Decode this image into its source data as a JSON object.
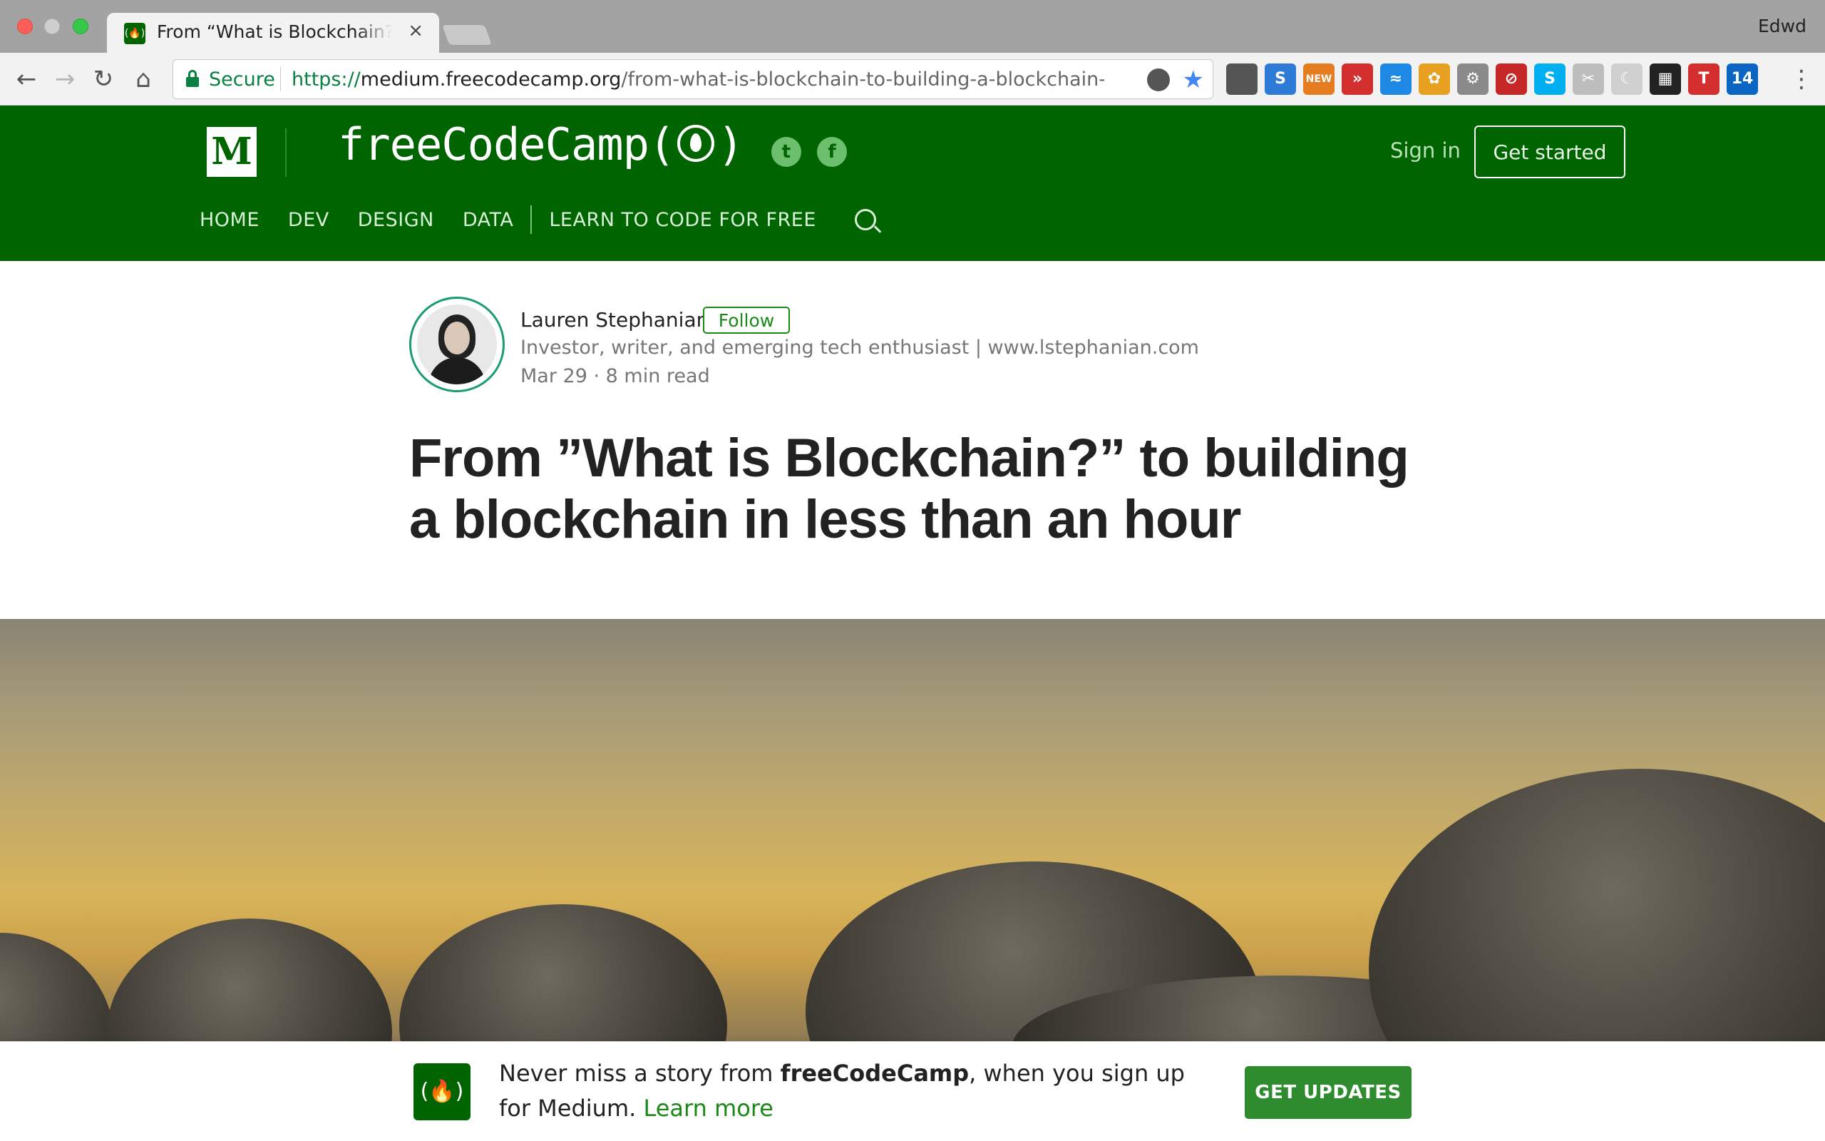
{
  "browser": {
    "tab_title": "From “What is Blockchain?” to building a blockchain in less than an hour",
    "tab_close": "×",
    "profile": "Edwd",
    "secure_label": "Secure",
    "url_scheme": "https://",
    "url_host": "medium.freecodecamp.org",
    "url_path": "/from-what-is-blockchain-to-building-a-blockchain-wit...",
    "back": "←",
    "forward": "→",
    "reload": "↻",
    "home": "⌂",
    "star": "★",
    "menu": "⋮",
    "extensions": [
      {
        "name": "evernote-icon",
        "color": "#555555",
        "label": ""
      },
      {
        "name": "s-icon",
        "color": "#2d7bd6",
        "label": "S"
      },
      {
        "name": "new-icon",
        "color": "#e57c1f",
        "label": "NEW"
      },
      {
        "name": "forward-icon",
        "color": "#d32f2f",
        "label": "»"
      },
      {
        "name": "sync-icon",
        "color": "#1e88e5",
        "label": "≈"
      },
      {
        "name": "flower-icon",
        "color": "#e8a020",
        "label": "✿"
      },
      {
        "name": "gear-icon",
        "color": "#8a8a8a",
        "label": "⚙"
      },
      {
        "name": "block-icon",
        "color": "#c62828",
        "label": "⊘"
      },
      {
        "name": "skype-icon",
        "color": "#00aff0",
        "label": "S"
      },
      {
        "name": "scissors-icon",
        "color": "#bdbdbd",
        "label": "✂"
      },
      {
        "name": "moon-icon",
        "color": "#d0d0d0",
        "label": "☾"
      },
      {
        "name": "grid-icon",
        "color": "#222222",
        "label": "▦"
      },
      {
        "name": "t-icon",
        "color": "#d32f2f",
        "label": "T"
      },
      {
        "name": "linkedin-icon",
        "color": "#0a66c2",
        "label": "14"
      }
    ]
  },
  "site": {
    "logo_letter": "M",
    "publication": "freeCodeCamp(",
    "publication_end": ")",
    "twitter_glyph": "t",
    "facebook_glyph": "f",
    "sign_in": "Sign in",
    "get_started": "Get started",
    "nav": [
      "HOME",
      "DEV",
      "DESIGN",
      "DATA",
      "LEARN TO CODE FOR FREE"
    ]
  },
  "article": {
    "author": "Lauren Stephanian",
    "follow": "Follow",
    "bio": "Investor, writer, and emerging tech enthusiast | www.lstephanian.com",
    "date": "Mar 29",
    "meta_sep": "·",
    "read_time": "8 min read",
    "headline": "From ”What is Blockchain?” to building a blockchain in less than an hour"
  },
  "bottom_bar": {
    "text_1": "Never miss a story from ",
    "publication": "freeCodeCamp",
    "text_2": ", when you sign up for Medium. ",
    "learn_more": "Learn more",
    "get_updates": "GET UPDATES"
  },
  "colors": {
    "brand_green": "#006400",
    "accent_green": "#1a8917"
  }
}
